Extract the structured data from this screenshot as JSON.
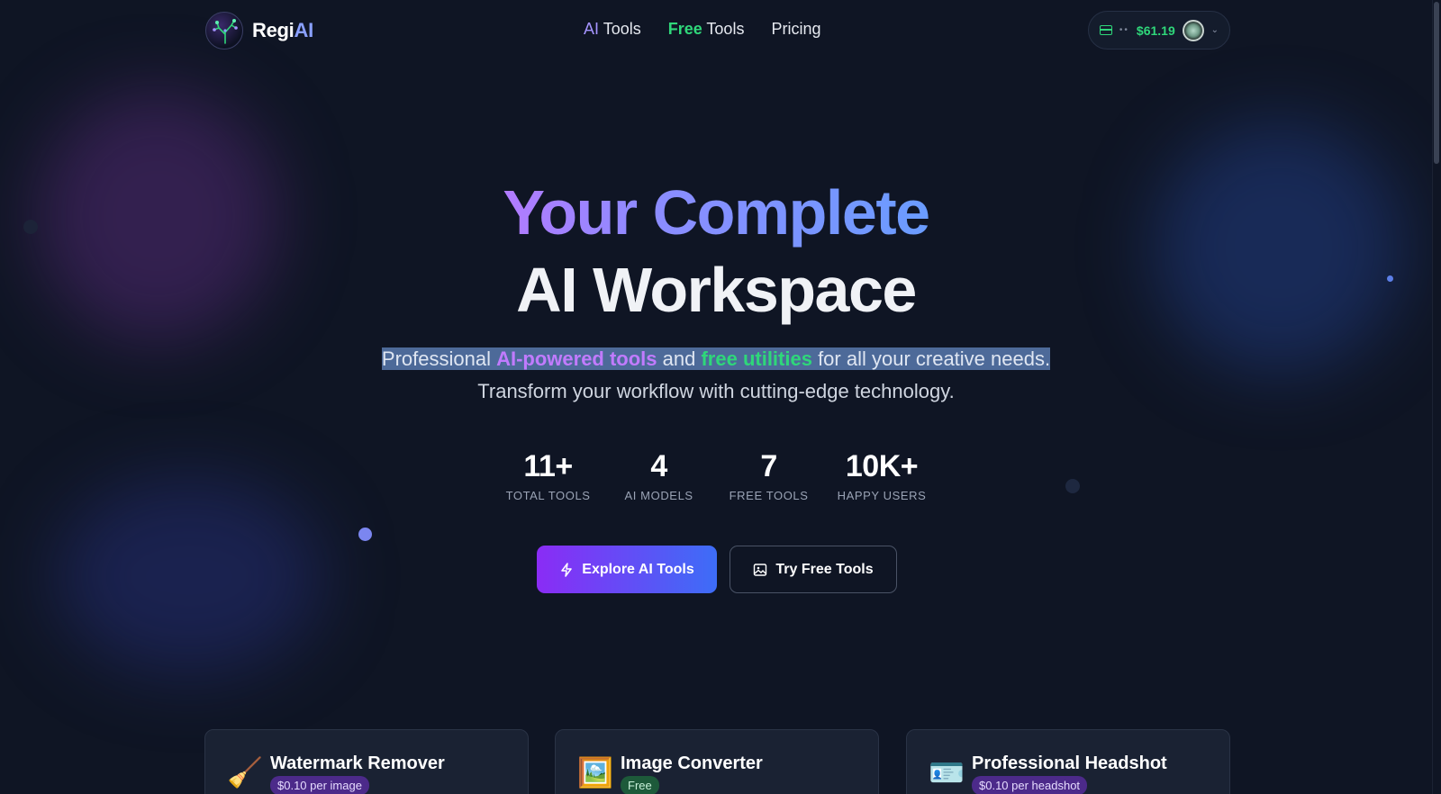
{
  "brand": {
    "name_part1": "Regi",
    "name_part2": "AI"
  },
  "nav": [
    {
      "accent": "AI",
      "rest": " Tools"
    },
    {
      "accent": "Free",
      "rest": " Tools"
    },
    {
      "label": "Pricing"
    }
  ],
  "wallet": {
    "masked": "••",
    "balance": "$61.19"
  },
  "hero": {
    "title_line1": "Your Complete",
    "title_line2": "AI Workspace",
    "subtitle_parts": {
      "p1": "Professional ",
      "ai": "AI-powered tools",
      "p2": " and ",
      "free": "free utilities",
      "p3": " for all your creative ",
      "p4": "needs.",
      "p5": " Transform your workflow with cutting-edge technology."
    }
  },
  "stats": [
    {
      "value": "11+",
      "label": "TOTAL TOOLS"
    },
    {
      "value": "4",
      "label": "AI MODELS"
    },
    {
      "value": "7",
      "label": "FREE TOOLS"
    },
    {
      "value": "10K+",
      "label": "HAPPY USERS"
    }
  ],
  "buttons": {
    "primary": "Explore AI Tools",
    "secondary": "Try Free Tools"
  },
  "cards": [
    {
      "emoji": "🧹",
      "title": "Watermark Remover",
      "badge": "$0.10 per image"
    },
    {
      "emoji": "🖼️",
      "title": "Image Converter",
      "badge": "Free"
    },
    {
      "emoji": "🪪",
      "title": "Professional Headshot",
      "badge": "$0.10 per headshot"
    }
  ],
  "icons": {
    "logo": "neural-tree-logo-icon",
    "wallet": "credit-card-icon",
    "avatar": "user-avatar",
    "dropdown": "chevron-down-icon",
    "primary_btn": "lightning-icon",
    "secondary_btn": "image-icon"
  },
  "colors": {
    "background": "#0f1524",
    "accent_purple": "#a594ff",
    "accent_green": "#2fd77a",
    "primary_gradient_start": "#8a2cf5",
    "primary_gradient_end": "#3d6df7"
  }
}
